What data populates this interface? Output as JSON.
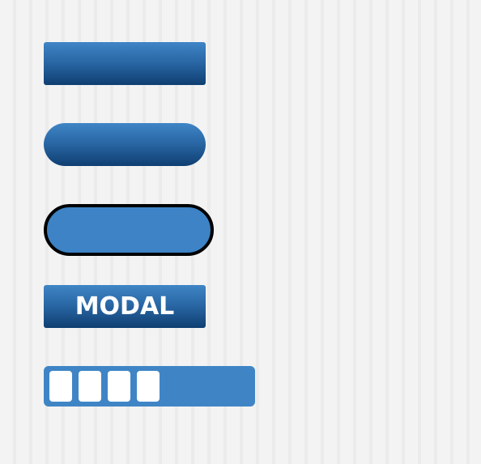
{
  "buttons": {
    "rect_button": {
      "label": ""
    },
    "pill_button": {
      "label": ""
    },
    "outline_pill_button": {
      "label": ""
    },
    "modal_button": {
      "label": "MODAL"
    }
  },
  "progress": {
    "filled_blocks": 4,
    "fraction": 0.45
  },
  "colors": {
    "button_gradient_top": "#3f85c6",
    "button_gradient_bottom": "#0f3f72",
    "button_flat": "#3d83c5",
    "outline": "#000000",
    "progress_block": "#ffffff",
    "background": "#f1f1f1"
  }
}
